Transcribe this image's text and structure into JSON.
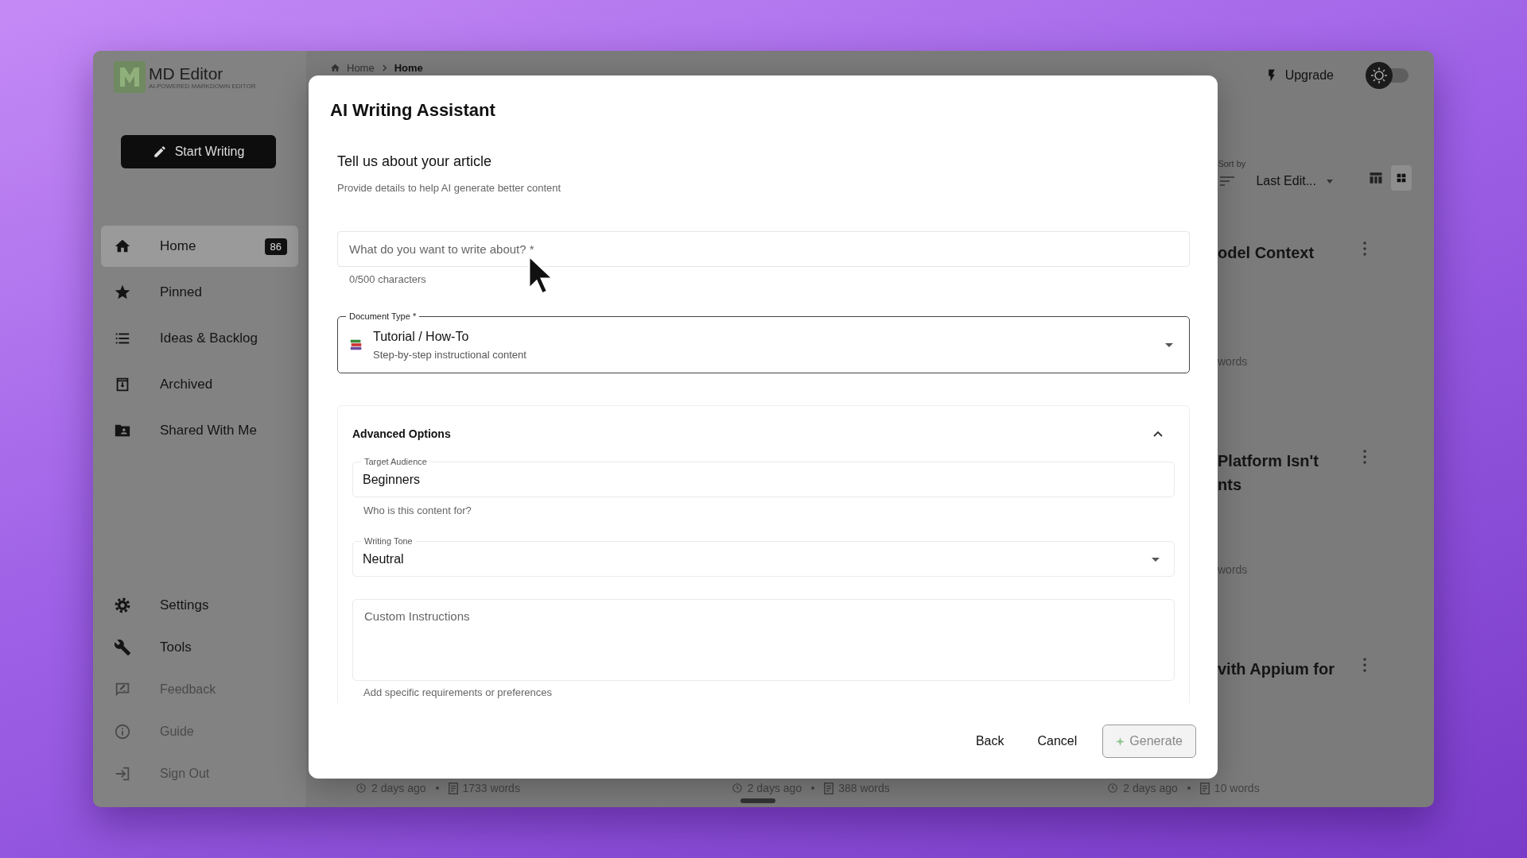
{
  "app": {
    "name": "MD Editor",
    "tagline": "AI-POWERED MARKDOWN EDITOR"
  },
  "start_button": "Start Writing",
  "nav": [
    {
      "label": "Home",
      "badge": "86",
      "selected": true,
      "muted": false
    },
    {
      "label": "Pinned",
      "selected": false,
      "muted": false
    },
    {
      "label": "Ideas & Backlog",
      "selected": false,
      "muted": false
    },
    {
      "label": "Archived",
      "selected": false,
      "muted": false
    },
    {
      "label": "Shared With Me",
      "selected": false,
      "muted": false
    }
  ],
  "nav_bottom": [
    {
      "label": "Settings",
      "selected": false,
      "muted": false
    },
    {
      "label": "Tools",
      "selected": false,
      "muted": false
    },
    {
      "label": "Feedback",
      "selected": false,
      "muted": true
    },
    {
      "label": "Guide",
      "selected": false,
      "muted": true
    },
    {
      "label": "Sign Out",
      "selected": false,
      "muted": true
    }
  ],
  "breadcrumb": [
    "Home",
    "Home"
  ],
  "upgrade": "Upgrade",
  "theme_toggle": {
    "on": false
  },
  "sort": {
    "label": "Sort by",
    "value": "Last Edit..."
  },
  "view_modes": [
    {
      "kind": "columns",
      "selected": false
    },
    {
      "kind": "grid",
      "selected": true
    }
  ],
  "cards": [
    {
      "title_lines": [
        "odel Context"
      ],
      "meta": "words"
    },
    {
      "title_lines": [
        "Platform Isn't",
        "nts"
      ],
      "meta": "words"
    },
    {
      "title_lines": [
        "vith Appium for"
      ]
    }
  ],
  "card_footers": [
    {
      "time": "2 days ago",
      "words": "1733 words"
    },
    {
      "time": "2 days ago",
      "words": "388 words"
    },
    {
      "time": "2 days ago",
      "words": "10 words"
    }
  ],
  "modal": {
    "title": "AI Writing Assistant",
    "heading": "Tell us about your article",
    "subtitle": "Provide details to help AI generate better content",
    "topic": {
      "placeholder": "What do you want to write about? *",
      "helper": "0/500 characters"
    },
    "document_type": {
      "label": "Document Type *",
      "value": "Tutorial / How-To",
      "description": "Step-by-step instructional content"
    },
    "advanced": {
      "title": "Advanced Options",
      "expanded": true,
      "audience": {
        "label": "Target Audience",
        "value": "Beginners",
        "helper": "Who is this content for?"
      },
      "tone": {
        "label": "Writing Tone",
        "value": "Neutral"
      },
      "instructions": {
        "placeholder": "Custom Instructions",
        "helper": "Add specific requirements or preferences"
      }
    },
    "buttons": [
      {
        "label": "Back",
        "kind": "text",
        "disabled": false
      },
      {
        "label": "Cancel",
        "kind": "text",
        "disabled": false
      },
      {
        "label": "Generate",
        "kind": "primary",
        "disabled": true
      }
    ]
  }
}
